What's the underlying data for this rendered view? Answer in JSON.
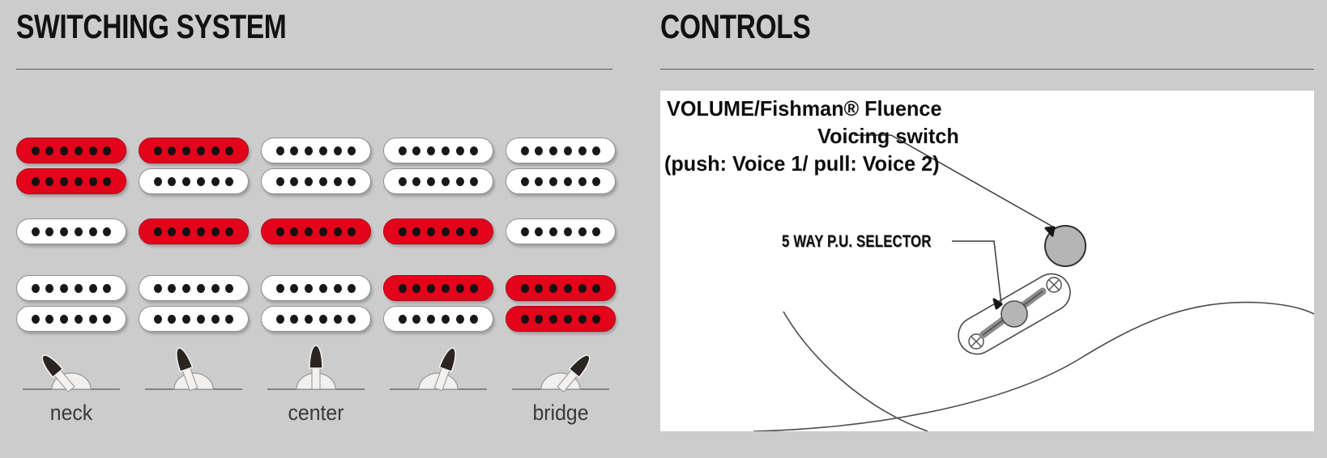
{
  "sections": {
    "switching": {
      "title": "SWITCHING SYSTEM"
    },
    "controls": {
      "title": "CONTROLS"
    }
  },
  "colors": {
    "background": "#cccccc",
    "panel": "#ffffff",
    "active_pickup": "#e3031a",
    "inactive_pickup": "#ffffff",
    "pole_piece": "#1a1718",
    "rule": "#595959",
    "text": "#111214",
    "knob_fill": "#b5b5b5",
    "line": "#3a3a3a"
  },
  "switching_system": {
    "pole_count": 6,
    "positions": [
      {
        "index": 1,
        "label": "neck",
        "lever_angle_deg": -40,
        "rows": [
          {
            "row": "neck",
            "coils": [
              "red",
              "red"
            ]
          },
          {
            "row": "middle",
            "coils": [
              "white"
            ]
          },
          {
            "row": "bridge",
            "coils": [
              "white",
              "white"
            ]
          }
        ]
      },
      {
        "index": 2,
        "label": "",
        "lever_angle_deg": -20,
        "rows": [
          {
            "row": "neck",
            "coils": [
              "red",
              "white"
            ]
          },
          {
            "row": "middle",
            "coils": [
              "red"
            ]
          },
          {
            "row": "bridge",
            "coils": [
              "white",
              "white"
            ]
          }
        ]
      },
      {
        "index": 3,
        "label": "center",
        "lever_angle_deg": 0,
        "rows": [
          {
            "row": "neck",
            "coils": [
              "white",
              "white"
            ]
          },
          {
            "row": "middle",
            "coils": [
              "red"
            ]
          },
          {
            "row": "bridge",
            "coils": [
              "white",
              "white"
            ]
          }
        ]
      },
      {
        "index": 4,
        "label": "",
        "lever_angle_deg": 20,
        "rows": [
          {
            "row": "neck",
            "coils": [
              "white",
              "white"
            ]
          },
          {
            "row": "middle",
            "coils": [
              "red"
            ]
          },
          {
            "row": "bridge",
            "coils": [
              "red",
              "white"
            ]
          }
        ]
      },
      {
        "index": 5,
        "label": "bridge",
        "lever_angle_deg": 40,
        "rows": [
          {
            "row": "neck",
            "coils": [
              "white",
              "white"
            ]
          },
          {
            "row": "middle",
            "coils": [
              "white"
            ]
          },
          {
            "row": "bridge",
            "coils": [
              "red",
              "red"
            ]
          }
        ]
      }
    ]
  },
  "controls": {
    "volume_label_line1": "VOLUME/Fishman® Fluence",
    "volume_label_line2": "Voicing switch",
    "volume_label_line3": "(push: Voice 1/ pull: Voice 2)",
    "selector_label": "5 WAY P.U. SELECTOR",
    "parts": [
      {
        "name": "volume-knob",
        "shape": "circle"
      },
      {
        "name": "pickup-selector-switch",
        "shape": "lever-on-plate",
        "screws": 2
      }
    ]
  }
}
